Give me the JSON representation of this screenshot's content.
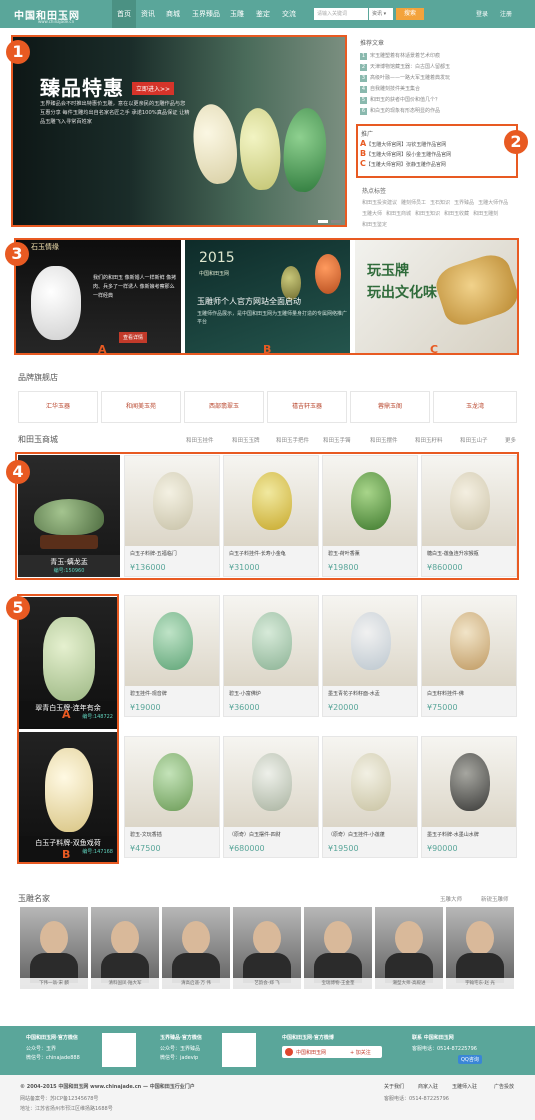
{
  "nav": {
    "logo": "中国和田玉网",
    "logo_sub": "www.chinajade.cn",
    "items": [
      "首页",
      "资讯",
      "商城",
      "玉界臻品",
      "玉雕",
      "鉴定",
      "交流"
    ],
    "search_placeholder": "请输入关键词",
    "search_scope": "资讯",
    "search_button": "搜索",
    "login": "登录",
    "register": "注册"
  },
  "hero": {
    "title": "臻品特惠",
    "tag": "立即进入>>",
    "desc": "玉界臻品会不时推出特惠价玉雕，意在以更亲民的玉雕作品与您互惠分享 每件玉雕均出自名家名匠之手 承诺100%真品保证 让精品玉雕飞入寻常百姓家"
  },
  "badges": [
    "1",
    "2",
    "3",
    "4",
    "5"
  ],
  "articles": {
    "title": "推荐文章",
    "items": [
      "宋玉雕塑着有林适景着艺术印痕",
      "天津博物馆藏玉器：白古国人留都玉",
      "高级叶融——一路大军玉雕着典发玩",
      "自我雕刻技件美玉集合",
      "和田玉的获者中国价和值几个？",
      "和白玉的现象有形态明显的作品"
    ]
  },
  "ads": {
    "title": "推广",
    "items": [
      {
        "letter": "A",
        "text": "【玉雕大师官网】冯钦玉雕作品官网"
      },
      {
        "letter": "B",
        "text": "【玉雕大师官网】殷小金玉雕作品官网"
      },
      {
        "letter": "C",
        "text": "【玉雕大师官网】张静玉雕作品官网"
      }
    ]
  },
  "tags": {
    "title": "热点标签",
    "items": [
      "和田玉投资建议",
      "雕刻师员工",
      "玉石知识",
      "玉界臻品",
      "玉雕大师作品",
      "玉雕大师",
      "和田玉商城",
      "和田玉知识",
      "和田玉收藏",
      "和田玉雕刻",
      "和田玉鉴定"
    ]
  },
  "banners": {
    "a_label": "A",
    "b_label": "B",
    "c_label": "C",
    "a_brand": "石玉情缘",
    "a_text": "我们的和田玉 像新婚人一样新鲜 像拷肉、兵多了一样诱人 像新娘考察那么一样经典",
    "a_button": "查看详情",
    "b_year": "2015",
    "b_site": "中国和田玉网",
    "b_title": "玉雕师个人官方网站全面启动",
    "b_sub": "玉雕师作品展示，是中国和田玉网为玉雕师量身打造的专属网络推广平台",
    "c_line1": "玩玉牌",
    "c_line2": "玩出文化味"
  },
  "brands": {
    "title": "品牌旗舰店",
    "items": [
      "汇华玉器",
      "和闻美玉苑",
      "西部翡翠玉",
      "禧吉轩玉器",
      "蓉鼎玉阁",
      "玉龙湾"
    ]
  },
  "mall": {
    "title": "和田玉商城",
    "cats": [
      "和田玉挂件",
      "和田玉玉牌",
      "和田玉手把件",
      "和田玉手镯",
      "和田玉摆件",
      "和田玉籽料",
      "和田玉山子",
      "更多"
    ],
    "featured": {
      "name": "青玉-螭龙盂",
      "code": "编号:150960"
    },
    "row1": [
      {
        "name": "白玉子料牌-五福临门",
        "price": "¥136000"
      },
      {
        "name": "白玉子料挂件-长寿小金龟",
        "price": "¥31000"
      },
      {
        "name": "碧玉-荷叶香薰",
        "price": "¥19800"
      },
      {
        "name": "糖白玉-莲鱼连升宗猴瓶",
        "price": "¥860000"
      }
    ],
    "featA": {
      "name": "翠青白玉牌-连年有余",
      "code": "编号:148722",
      "label": "A"
    },
    "featB": {
      "name": "白玉子料牌-双鱼戏荷",
      "code": "编号:147168",
      "label": "B"
    },
    "row2": [
      {
        "name": "碧玉挂件-观音牌",
        "price": "¥19000"
      },
      {
        "name": "碧玉-小富佛炉",
        "price": "¥36000"
      },
      {
        "name": "墨玉青花子料籽面-水盂",
        "price": "¥20000"
      },
      {
        "name": "白玉籽料挂件-佛",
        "price": "¥75000"
      }
    ],
    "row3": [
      {
        "name": "碧玉-文玩香插",
        "price": "¥47500"
      },
      {
        "name": "（原奇）白玉摆件-四财",
        "price": "¥680000"
      },
      {
        "name": "（原奇）白玉挂件-小莲蓬",
        "price": "¥19500"
      },
      {
        "name": "墨玉子料牌-水墨山水牌",
        "price": "¥90000"
      }
    ]
  },
  "masters": {
    "title": "玉雕名家",
    "links": [
      "玉雕大师",
      "新锐玉雕师"
    ],
    "items": [
      "下伟一翁·宋 麟",
      "清料国凤·陆大军",
      "清高启遥·万 伟",
      "艺韵会·郑 飞",
      "宝瑞博物·王金奎",
      "潮型大师·高殿进",
      "宇翰宅东·赵 光"
    ]
  },
  "footer": {
    "col1_title": "中国和田玉网·官方微信",
    "col1_a": "公众号：玉界",
    "col1_b": "微信号：chinajade888",
    "col2_title": "玉界臻品·官方微信",
    "col2_a": "公众号：玉界臻品",
    "col2_b": "微信号：jadevip",
    "col3_title": "中国和田玉网·官方微博",
    "col3_btn": "中国和田玉网",
    "col3_follow": "+ 加关注",
    "col4_title": "联系 中国和田玉网",
    "col4_a": "客服电话：0514-87225796",
    "col4_b": "QQ咨询",
    "copyright": "© 2004-2015 中国和田玉网 www.chinajade.cn — 中国和田玉行业门户",
    "links": [
      "关于我们",
      "商家入驻",
      "玉雕师入驻",
      "广告投放"
    ],
    "icp": "网站备案号：苏ICP备12345678号",
    "addr": "地址：江苏省扬州市邗江区维扬路1688号",
    "tel": "客服电话：0514-87225796"
  }
}
